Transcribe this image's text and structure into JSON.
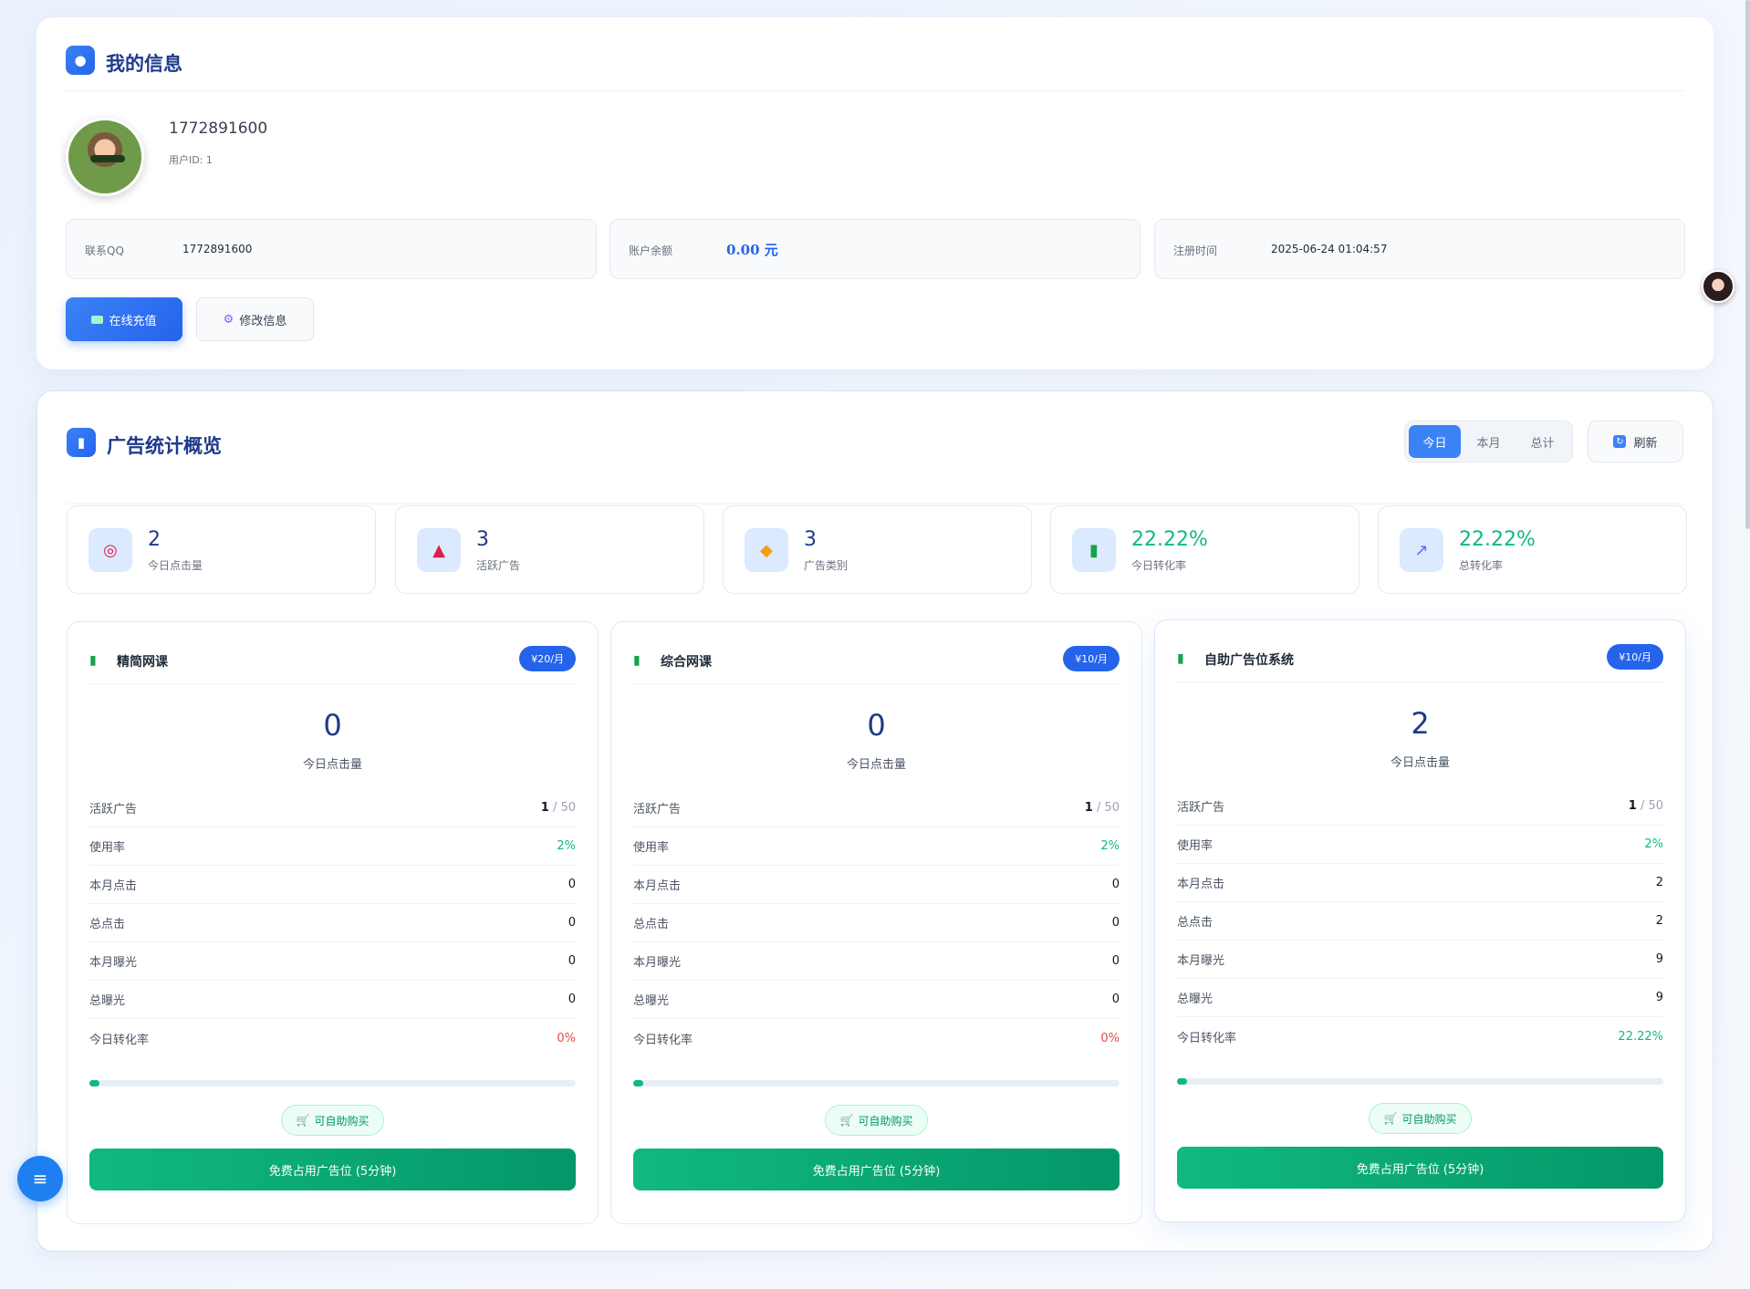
{
  "profile": {
    "section_title": "我的信息",
    "section_icon": "user-icon",
    "username": "1772891600",
    "user_id": "用户ID: 1",
    "info": [
      {
        "label": "联系QQ",
        "value": "1772891600"
      },
      {
        "label": "账户余额",
        "value": "0.00 元"
      },
      {
        "label": "注册时间",
        "value": "2025-06-24 01:04:57"
      }
    ],
    "recharge_label": "在线充值",
    "edit_label": "修改信息"
  },
  "stats": {
    "section_title": "广告统计概览",
    "tabs": [
      "今日",
      "本月",
      "总计"
    ],
    "active_tab": "今日",
    "refresh_label": "刷新",
    "tiles": [
      {
        "value": "2",
        "label": "今日点击量",
        "icon": "target-icon"
      },
      {
        "value": "3",
        "label": "活跃广告",
        "icon": "megaphone-icon"
      },
      {
        "value": "3",
        "label": "广告类别",
        "icon": "tag-icon"
      },
      {
        "value": "22.22%",
        "label": "今日转化率",
        "icon": "bar-chart-icon"
      },
      {
        "value": "22.22%",
        "label": "总转化率",
        "icon": "trend-chart-icon"
      }
    ]
  },
  "ads": [
    {
      "title": "精简网课",
      "price": "¥20/月",
      "today_clicks": "0",
      "today_clicks_label": "今日点击量",
      "active_label": "活跃广告",
      "active_cur": "1",
      "active_total": " / 50",
      "usage_label": "使用率",
      "usage": "2%",
      "usage_fraction": 0.02,
      "month_clicks_label": "本月点击",
      "month_clicks": "0",
      "total_clicks_label": "总点击",
      "total_clicks": "0",
      "month_views_label": "本月曝光",
      "month_views": "0",
      "total_views_label": "总曝光",
      "total_views": "0",
      "conv_label": "今日转化率",
      "conv": "0%",
      "buy_label": "可自助购买",
      "occupy_label": "免费占用广告位 (5分钟)"
    },
    {
      "title": "综合网课",
      "price": "¥10/月",
      "today_clicks": "0",
      "today_clicks_label": "今日点击量",
      "active_label": "活跃广告",
      "active_cur": "1",
      "active_total": " / 50",
      "usage_label": "使用率",
      "usage": "2%",
      "usage_fraction": 0.02,
      "month_clicks_label": "本月点击",
      "month_clicks": "0",
      "total_clicks_label": "总点击",
      "total_clicks": "0",
      "month_views_label": "本月曝光",
      "month_views": "0",
      "total_views_label": "总曝光",
      "total_views": "0",
      "conv_label": "今日转化率",
      "conv": "0%",
      "buy_label": "可自助购买",
      "occupy_label": "免费占用广告位 (5分钟)"
    },
    {
      "title": "自助广告位系统",
      "price": "¥10/月",
      "today_clicks": "2",
      "today_clicks_label": "今日点击量",
      "active_label": "活跃广告",
      "active_cur": "1",
      "active_total": " / 50",
      "usage_label": "使用率",
      "usage": "2%",
      "usage_fraction": 0.02,
      "month_clicks_label": "本月点击",
      "month_clicks": "2",
      "total_clicks_label": "总点击",
      "total_clicks": "2",
      "month_views_label": "本月曝光",
      "month_views": "9",
      "total_views_label": "总曝光",
      "total_views": "9",
      "conv_label": "今日转化率",
      "conv": "22.22%",
      "buy_label": "可自助购买",
      "occupy_label": "免费占用广告位 (5分钟)"
    }
  ],
  "colors": {
    "accent": "#3b82f6",
    "title": "#1e3a8a",
    "success": "#10b981",
    "danger": "#ef4444"
  }
}
